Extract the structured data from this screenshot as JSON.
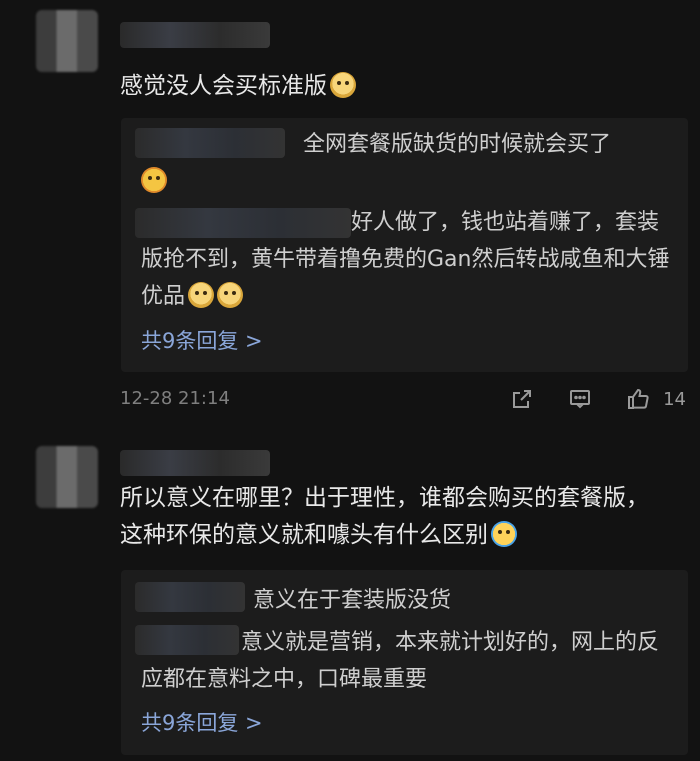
{
  "comments": [
    {
      "text": "感觉没人会买标准版",
      "emoji": "doge-icon",
      "replies": [
        {
          "text": "全网套餐版缺货的时候就会买了"
        },
        {
          "text": "好人做了，钱也站着赚了，套装版抢不到，黄牛带着撸免费的Gan然后转战咸鱼和大锤优品"
        }
      ],
      "more_replies": "共9条回复 >",
      "time": "12-28 21:14",
      "likes": "14"
    },
    {
      "text": "所以意义在哪里？出于理性，谁都会购买的套餐版，这种环保的意义就和噱头有什么区别",
      "emoji": "cry-laugh-icon",
      "replies": [
        {
          "text": "意义在于套装版没货"
        },
        {
          "text": "意义就是营销，本来就计划好的，网上的反应都在意料之中，口碑最重要"
        }
      ],
      "more_replies": "共9条回复 >"
    }
  ]
}
